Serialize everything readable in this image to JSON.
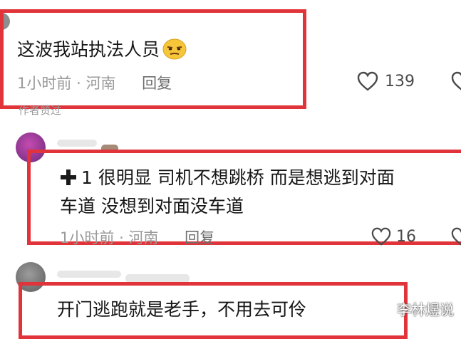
{
  "comments": [
    {
      "text": "这波我站执法人员",
      "emoji": "smirk-emoji",
      "time": "1小时前",
      "separator": "·",
      "location": "河南",
      "reply_label": "回复",
      "likes": "139",
      "badge": "作者赞过"
    },
    {
      "line1": "1 很明显 司机不想跳桥 而是想逃到对面",
      "line2": "车道 没想到对面没车道",
      "prefix_icon": "plus-icon",
      "time": "1小时前",
      "separator": "·",
      "location": "河南",
      "reply_label": "回复",
      "likes": "16"
    },
    {
      "text": "开门逃跑就是老手，不用去可伶"
    }
  ],
  "watermark": "李林煜说",
  "colors": {
    "highlight": "#e0343a",
    "meta": "#9a9a9a"
  }
}
